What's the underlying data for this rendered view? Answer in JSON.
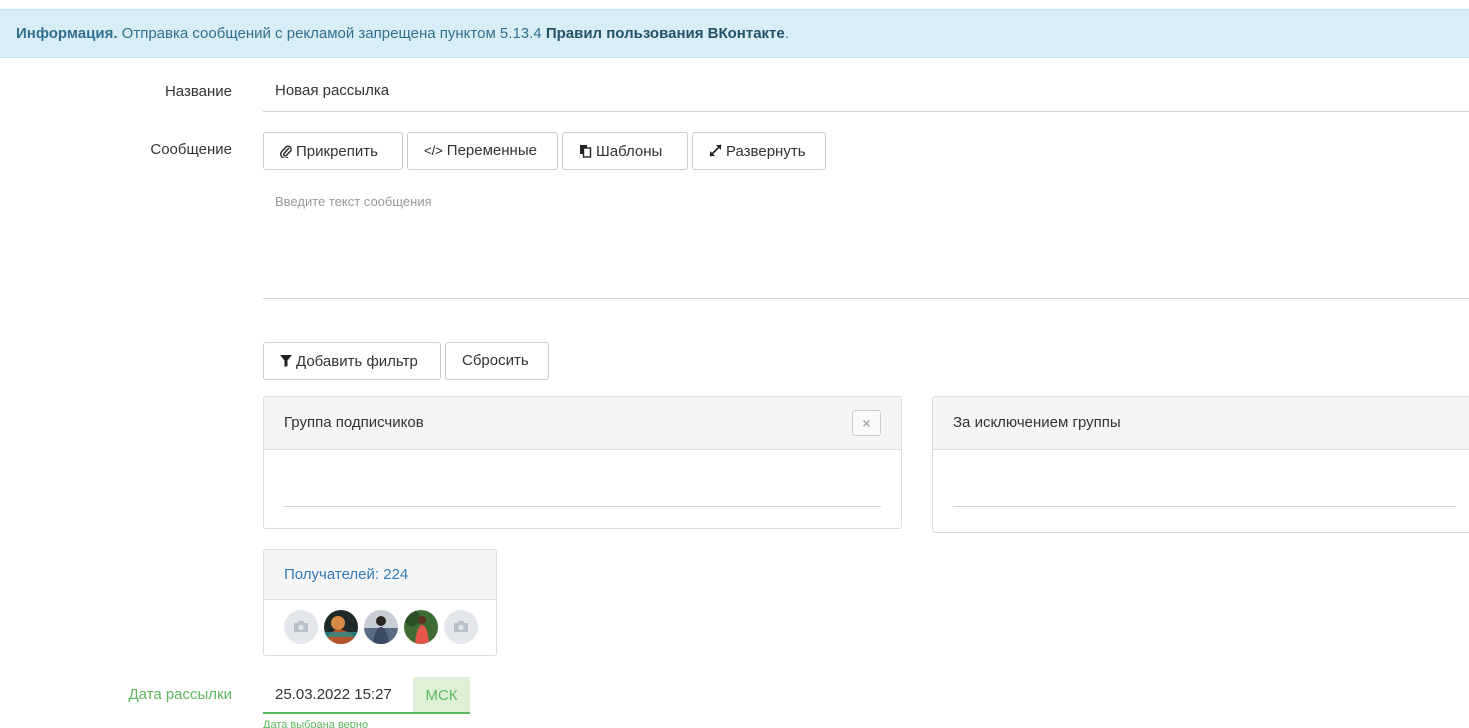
{
  "info_bar": {
    "bold_prefix": "Информация.",
    "text": "Отправка сообщений с рекламой запрещена пунктом 5.13.4",
    "link": "Правил пользования ВКонтакте",
    "suffix": "."
  },
  "form": {
    "name_label": "Название",
    "name_value": "Новая рассылка",
    "message_label": "Сообщение",
    "message_placeholder": "Введите текст сообщения",
    "toolbar": {
      "attach": "Прикрепить",
      "variables": "Переменные",
      "templates": "Шаблоны",
      "expand": "Развернуть"
    }
  },
  "filters": {
    "add_filter": "Добавить фильтр",
    "reset": "Сбросить",
    "subscriber_group_title": "Группа подписчиков",
    "close_label": "×",
    "exclude_group_title": "За исключением группы"
  },
  "recipients": {
    "label": "Получателей: 224",
    "avatars": [
      {
        "kind": "placeholder",
        "icon": "camera-icon"
      },
      {
        "kind": "photo",
        "color": "#b4552c"
      },
      {
        "kind": "photo",
        "color": "#3d4a63"
      },
      {
        "kind": "photo",
        "color": "#3f6b34"
      },
      {
        "kind": "placeholder",
        "icon": "camera-icon"
      }
    ]
  },
  "schedule": {
    "date_label": "Дата рассылки",
    "date_value": "25.03.2022 15:27",
    "timezone": "МСК",
    "hint": "Дата выбрана верно"
  },
  "colors": {
    "info_bg": "#d9edf7",
    "info_text": "#31708f",
    "success": "#5cb85c",
    "link": "#337ab7"
  }
}
